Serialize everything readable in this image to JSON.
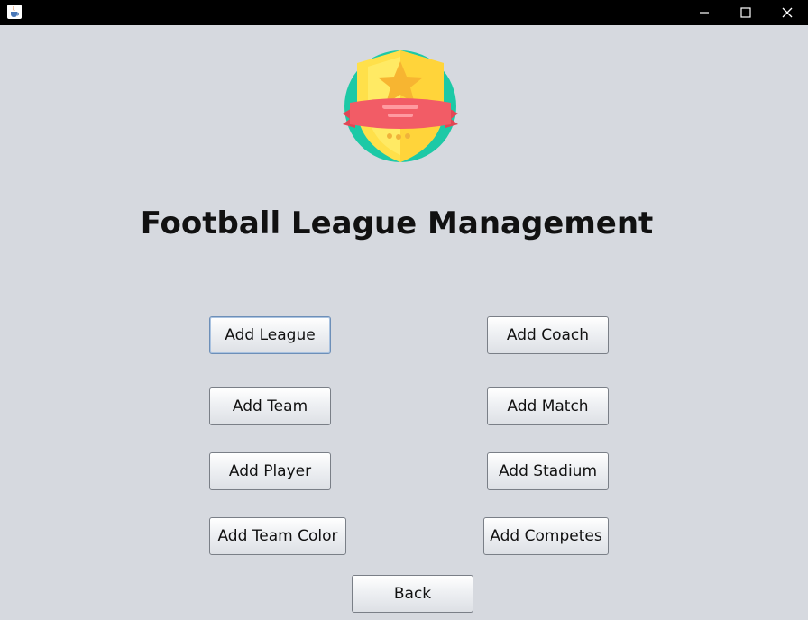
{
  "window": {
    "app_icon": "java-cup-icon",
    "controls": [
      "minimize-icon",
      "maximize-icon",
      "close-icon"
    ]
  },
  "logo": {
    "icon": "shield-badge-star-icon"
  },
  "title": "Football League Management",
  "buttons": {
    "add_league": "Add League",
    "add_coach": "Add Coach",
    "add_team": "Add Team",
    "add_match": "Add Match",
    "add_player": "Add Player",
    "add_stadium": "Add Stadium",
    "add_team_color": "Add Team Color",
    "add_competes": "Add Competes",
    "back": "Back"
  },
  "colors": {
    "background": "#d6d9df",
    "titlebar": "#000000",
    "shield_yellow": "#ffe04a",
    "ribbon_red": "#f25c66",
    "circle_teal": "#1dc9a6"
  }
}
